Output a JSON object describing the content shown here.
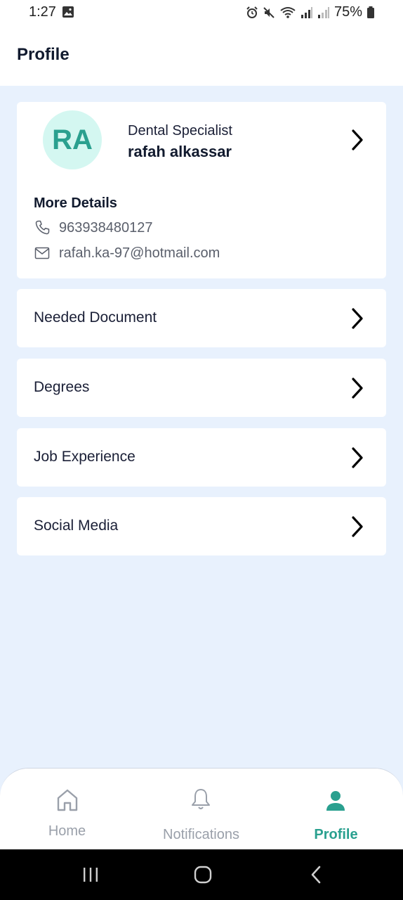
{
  "status_bar": {
    "time": "1:27",
    "battery": "75%",
    "icons": [
      "image-icon",
      "alarm-icon",
      "mute-icon",
      "wifi-icon",
      "signal-icon",
      "signal-icon",
      "battery-icon"
    ]
  },
  "header": {
    "title": "Profile"
  },
  "profile": {
    "initials": "RA",
    "role": "Dental Specialist",
    "name": "rafah alkassar",
    "more_details_label": "More Details",
    "phone": "963938480127",
    "email": "rafah.ka-97@hotmail.com"
  },
  "menu": [
    {
      "label": "Needed Document"
    },
    {
      "label": "Degrees"
    },
    {
      "label": "Job Experience"
    },
    {
      "label": "Social Media"
    }
  ],
  "bottom_nav": [
    {
      "label": "Home",
      "icon": "home-icon",
      "active": false
    },
    {
      "label": "Notifications",
      "icon": "bell-icon",
      "active": false
    },
    {
      "label": "Profile",
      "icon": "person-icon",
      "active": true
    }
  ],
  "colors": {
    "accent": "#2aa08f",
    "avatar_bg": "#d4f7f1",
    "page_bg": "#e8f1fd",
    "inactive_nav": "#9aa0aa"
  }
}
